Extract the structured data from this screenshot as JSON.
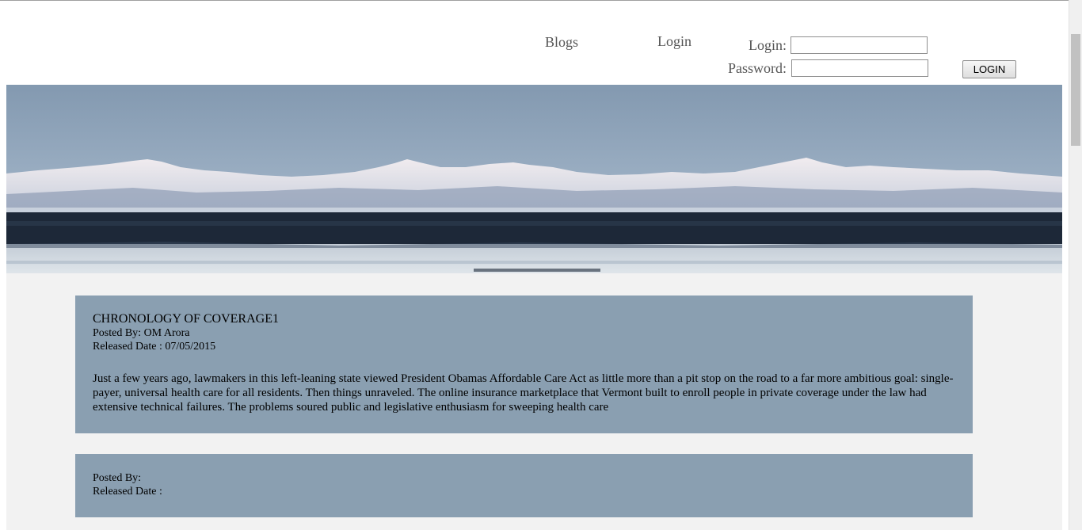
{
  "nav": {
    "blogs_label": "Blogs",
    "login_label": "Login"
  },
  "login_form": {
    "login_label": "Login:",
    "password_label": "Password:",
    "login_value": "",
    "password_value": "",
    "submit_label": "LOGIN"
  },
  "posts": [
    {
      "title": "CHRONOLOGY OF COVERAGE1",
      "posted_by": "Posted By: OM Arora",
      "released_date": "Released Date : 07/05/2015",
      "body": "Just a few years ago, lawmakers in this left-leaning state viewed President Obamas Affordable Care Act as little more than a pit stop on the road to a far more ambitious goal: single-payer, universal health care for all residents. Then things unraveled. The online insurance marketplace that Vermont built to enroll people in private coverage under the law had extensive technical failures. The problems soured public and legislative enthusiasm for sweeping health care"
    },
    {
      "title": "",
      "posted_by": "Posted By:",
      "released_date": "Released Date :",
      "body": ""
    }
  ],
  "colors": {
    "post_background": "#8a9fb1",
    "content_background": "#f2f2f2",
    "nav_text": "#555555"
  },
  "icons": {
    "banner": "snowy-mountain-lake-banner-image"
  }
}
